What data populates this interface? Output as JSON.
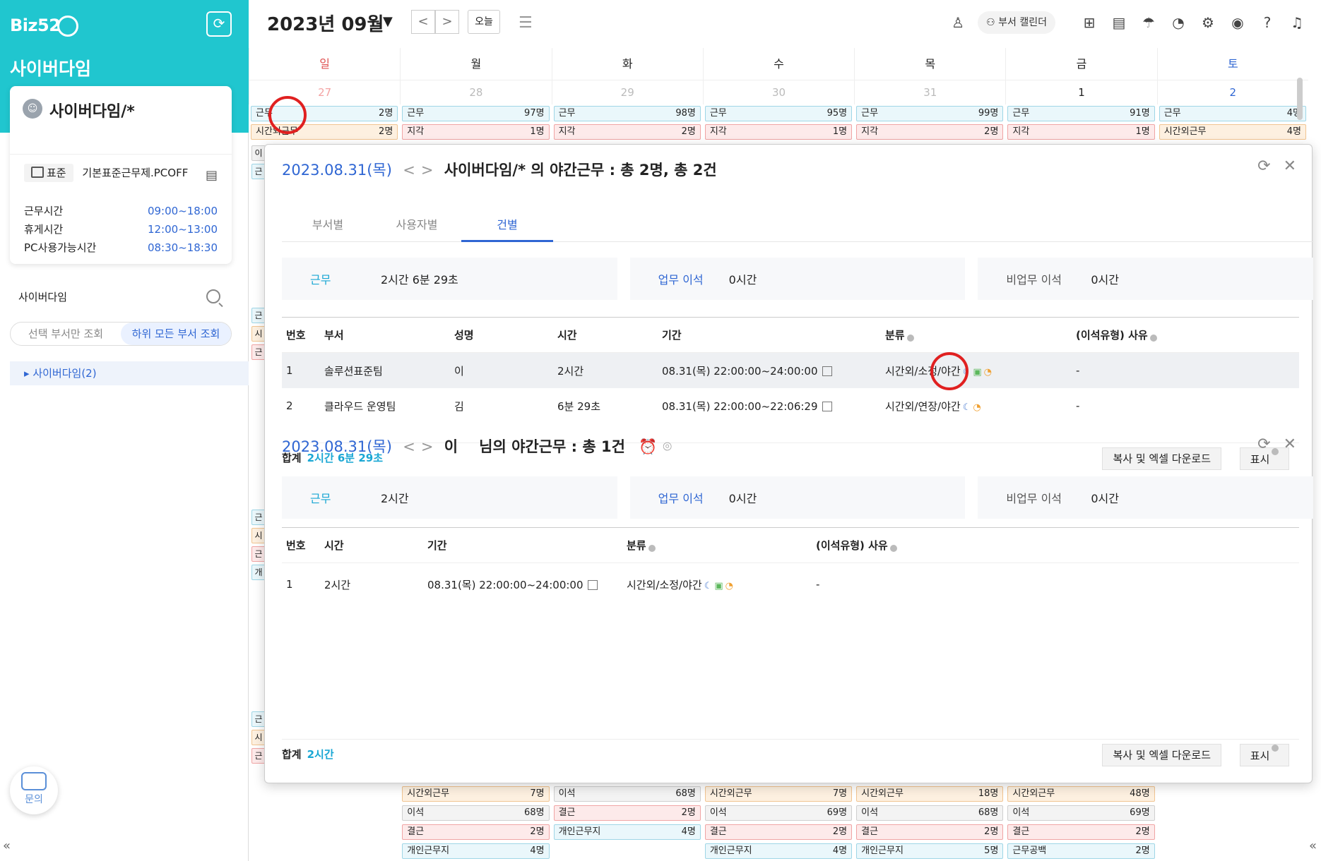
{
  "sidebar": {
    "logo": "Biz52",
    "org_title": "사이버다임",
    "user_name": "사이버다임/*",
    "work_type_badge": "표준",
    "work_type_name": "기본표준근무제.PCOFF",
    "rows": [
      {
        "label": "근무시간",
        "value": "09:00~18:00"
      },
      {
        "label": "휴게시간",
        "value": "12:00~13:00"
      },
      {
        "label": "PC사용가능시간",
        "value": "08:30~18:30"
      }
    ],
    "search_label": "사이버다임",
    "seg_left": "선택 부서만 조회",
    "seg_right": "하위 모든 부서 조회",
    "tree_item": "사이버다임(2)",
    "help_label": "문의",
    "collapse": "«"
  },
  "topbar": {
    "month": "2023년 09월",
    "caret": "▼",
    "prev": "<",
    "next": ">",
    "today": "오늘",
    "dept_calendar": "부서 캘린더"
  },
  "calendar": {
    "days": [
      "일",
      "월",
      "화",
      "수",
      "목",
      "금",
      "토"
    ],
    "dates": [
      "27",
      "28",
      "29",
      "30",
      "31",
      "1",
      "2"
    ],
    "row1": [
      {
        "label": "근무",
        "count": "2명"
      },
      {
        "label": "근무",
        "count": "97명"
      },
      {
        "label": "근무",
        "count": "98명"
      },
      {
        "label": "근무",
        "count": "95명"
      },
      {
        "label": "근무",
        "count": "99명"
      },
      {
        "label": "근무",
        "count": "91명"
      },
      {
        "label": "근무",
        "count": "4명"
      }
    ],
    "row2": [
      {
        "label": "시간외근무",
        "count": "2명"
      },
      {
        "label": "지각",
        "count": "1명"
      },
      {
        "label": "지각",
        "count": "2명"
      },
      {
        "label": "지각",
        "count": "1명"
      },
      {
        "label": "지각",
        "count": "2명"
      },
      {
        "label": "지각",
        "count": "1명"
      },
      {
        "label": "시간외근무",
        "count": "4명"
      }
    ],
    "bottom_rows": [
      [
        {
          "label": "시간외근무",
          "count": "7명"
        },
        {
          "label": "이석",
          "count": "68명"
        },
        {
          "label": "시간외근무",
          "count": "7명"
        },
        {
          "label": "시간외근무",
          "count": "18명"
        },
        {
          "label": "시간외근무",
          "count": "48명"
        }
      ],
      [
        {
          "label": "이석",
          "count": "68명"
        },
        {
          "label": "결근",
          "count": "2명"
        },
        {
          "label": "이석",
          "count": "69명"
        },
        {
          "label": "이석",
          "count": "68명"
        },
        {
          "label": "이석",
          "count": "69명"
        }
      ],
      [
        {
          "label": "결근",
          "count": "2명"
        },
        {
          "label": "개인근무지",
          "count": "4명"
        },
        {
          "label": "결근",
          "count": "2명"
        },
        {
          "label": "결근",
          "count": "2명"
        },
        {
          "label": "결근",
          "count": "2명"
        }
      ],
      [
        {
          "label": "개인근무지",
          "count": "4명"
        },
        {
          "label": "",
          "count": ""
        },
        {
          "label": "개인근무지",
          "count": "4명"
        },
        {
          "label": "개인근무지",
          "count": "5명"
        },
        {
          "label": "근무공백",
          "count": "2명"
        }
      ]
    ],
    "left_chip_groups": [
      [
        "이",
        "근"
      ],
      [
        "근",
        "시",
        "근"
      ],
      [
        "근",
        "시",
        "근",
        "개"
      ],
      [
        "근",
        "시",
        "근"
      ]
    ]
  },
  "modal1": {
    "date": "2023.08.31(목)",
    "title": "사이버다임/*  의 야간근무 : 총 2명, 총 2건",
    "tabs": [
      "부서별",
      "사용자별",
      "건별"
    ],
    "summary": [
      {
        "label": "근무",
        "value": "2시간 6분 29초"
      },
      {
        "label": "업무 이석",
        "value": "0시간"
      },
      {
        "label": "비업무 이석",
        "value": "0시간"
      }
    ],
    "headers": [
      "번호",
      "부서",
      "성명",
      "시간",
      "기간",
      "분류",
      "(이석유형) 사유"
    ],
    "rows": [
      {
        "no": "1",
        "dept": "솔루션표준팀",
        "name": "이",
        "time": "2시간",
        "period": "08.31(목) 22:00:00~24:00:00",
        "cls": "시간외/소정/야간",
        "reason": "-"
      },
      {
        "no": "2",
        "dept": "클라우드 운영팀",
        "name": "김",
        "time": "6분 29초",
        "period": "08.31(목) 22:00:00~22:06:29",
        "cls": "시간외/연장/야간",
        "reason": "-"
      }
    ],
    "total_label": "합계",
    "total_value": "2시간 6분 29초",
    "excel": "복사 및 엑셀 다운로드",
    "show": "표시"
  },
  "modal2": {
    "date": "2023.08.31(목)",
    "name": "이",
    "title": "님의 야간근무 : 총 1건",
    "summary": [
      {
        "label": "근무",
        "value": "2시간"
      },
      {
        "label": "업무 이석",
        "value": "0시간"
      },
      {
        "label": "비업무 이석",
        "value": "0시간"
      }
    ],
    "headers": [
      "번호",
      "시간",
      "기간",
      "분류",
      "(이석유형) 사유"
    ],
    "rows": [
      {
        "no": "1",
        "time": "2시간",
        "period": "08.31(목) 22:00:00~24:00:00",
        "cls": "시간외/소정/야간",
        "reason": "-"
      }
    ],
    "total_label": "합계",
    "total_value": "2시간",
    "excel": "복사 및 엑셀 다운로드",
    "show": "표시"
  },
  "colors": {
    "accent": "#20c6cf",
    "link": "#2f66d3",
    "highlight_circle": "#e02020"
  }
}
